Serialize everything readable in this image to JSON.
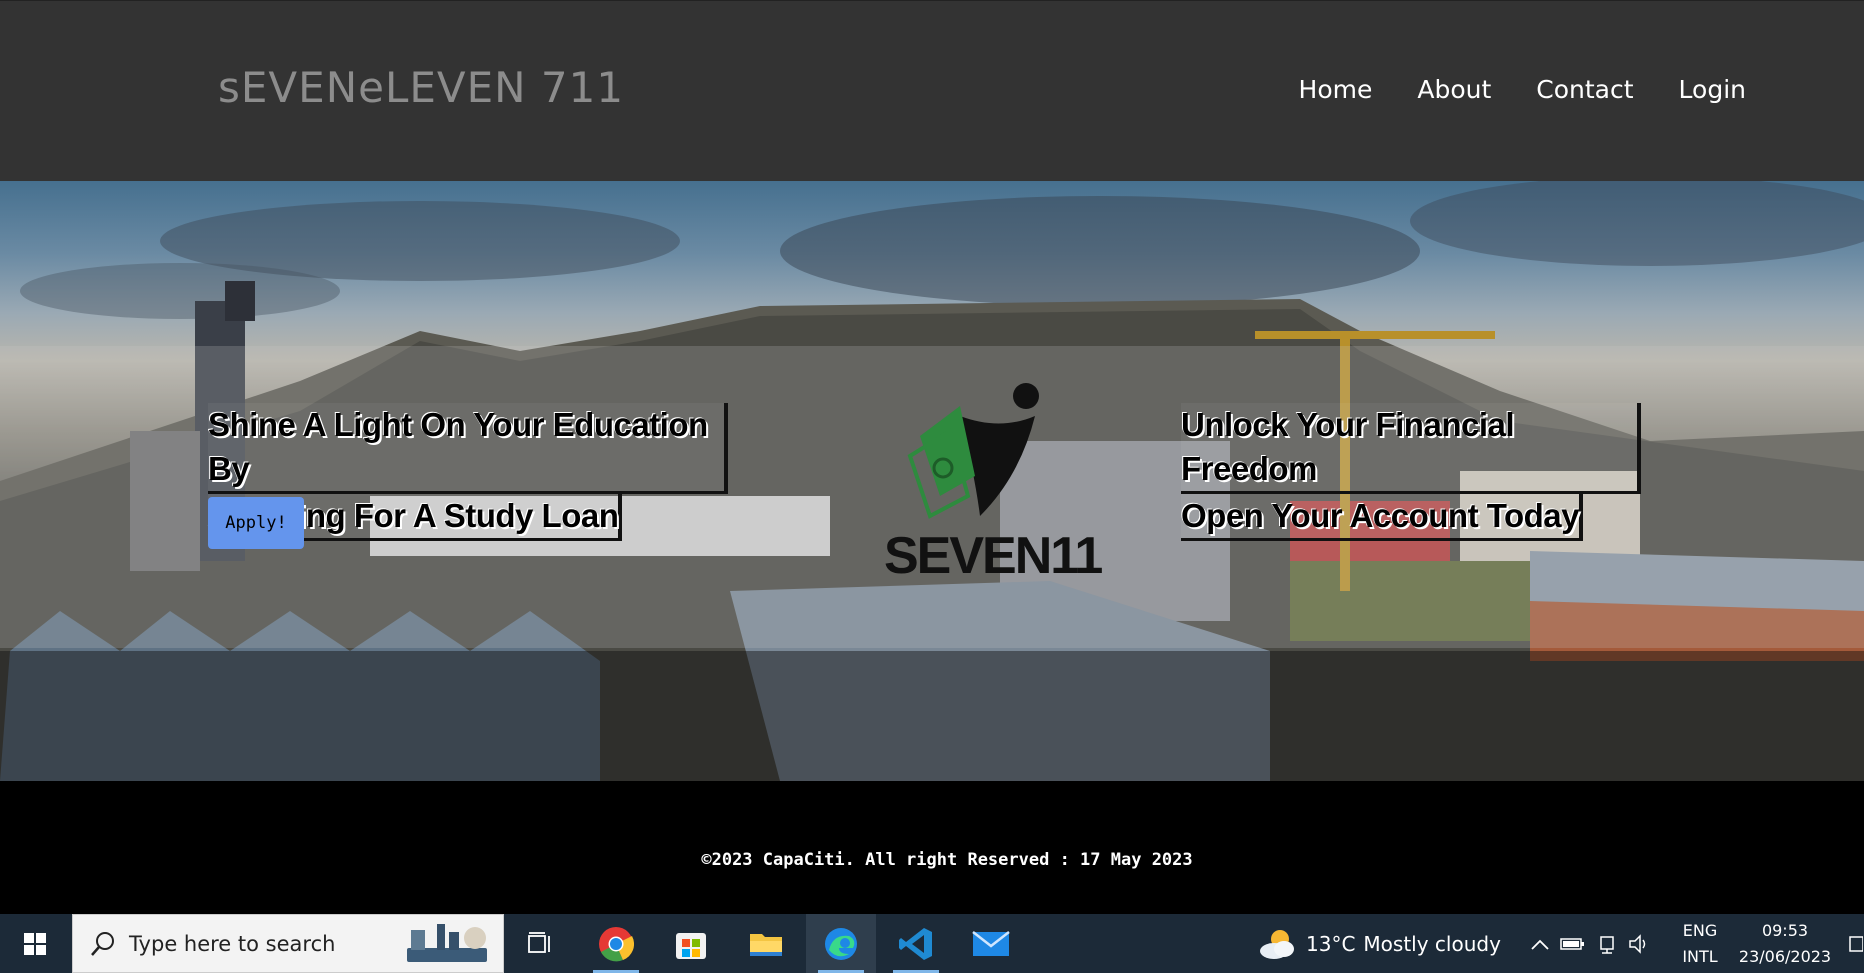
{
  "header": {
    "brand": "sEVENeLEVEN 711",
    "nav": [
      "Home",
      "About",
      "Contact",
      "Login"
    ]
  },
  "hero": {
    "left_tagline_line1": "Shine A Light On Your Education By",
    "left_tagline_line2": "Applying For A Study Loan",
    "apply_label": "Apply!",
    "right_tagline_line1": "Unlock Your Financial Freedom",
    "right_tagline_line2": "Open Your Account Today",
    "logo_text": "SEVEN11",
    "logo_colors": {
      "dark": "#111111",
      "green": "#2e8b3e"
    }
  },
  "footer": {
    "text": "©2023 CapaCiti. All right Reserved : 17 May 2023"
  },
  "taskbar": {
    "search_placeholder": "Type here to search",
    "apps": [
      "chrome-icon",
      "store-icon",
      "file-explorer-icon",
      "edge-icon",
      "vscode-icon",
      "mail-icon"
    ],
    "active_app": "edge-icon",
    "weather_temp": "13°C",
    "weather_desc": "Mostly cloudy",
    "lang1": "ENG",
    "lang2": "INTL",
    "time": "09:53",
    "date": "23/06/2023"
  },
  "colors": {
    "navbar": "#333333",
    "brand": "#8c8c8c",
    "apply_button": "#6495ed",
    "taskbar": "#1c2a38"
  }
}
